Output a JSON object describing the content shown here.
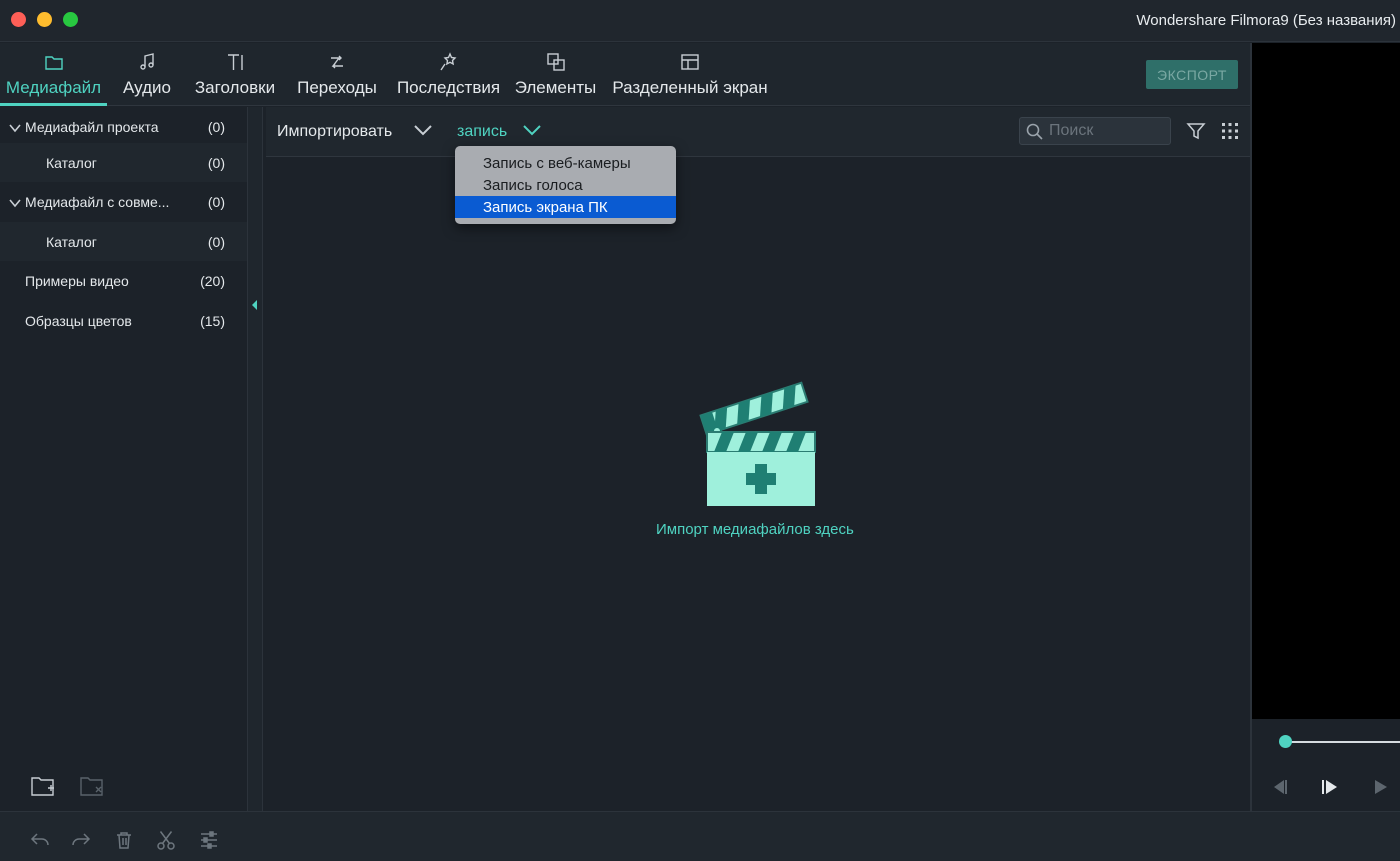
{
  "window": {
    "title": "Wondershare Filmora9 (Без названия)"
  },
  "tabs": [
    {
      "label": "Медиафайл",
      "icon": "folder-icon",
      "active": true
    },
    {
      "label": "Аудио",
      "icon": "music-note-icon",
      "active": false
    },
    {
      "label": "Заголовки",
      "icon": "text-icon",
      "active": false
    },
    {
      "label": "Переходы",
      "icon": "transition-icon",
      "active": false
    },
    {
      "label": "Последствия",
      "icon": "effects-icon",
      "active": false
    },
    {
      "label": "Элементы",
      "icon": "elements-icon",
      "active": false
    },
    {
      "label": "Разделенный экран",
      "icon": "split-screen-icon",
      "active": false
    }
  ],
  "export_label": "ЭКСПОРТ",
  "sidebar": {
    "items": [
      {
        "label": "Медиафайл проекта",
        "count": "(0)",
        "expanded": true
      },
      {
        "label": "Каталог",
        "count": "(0)"
      },
      {
        "label": "Медиафайл с совме...",
        "count": "(0)",
        "expanded": true
      },
      {
        "label": "Каталог",
        "count": "(0)"
      },
      {
        "label": "Примеры видео",
        "count": "(20)"
      },
      {
        "label": "Образцы цветов",
        "count": "(15)"
      }
    ]
  },
  "media_toolbar": {
    "import_label": "Импортировать",
    "record_label": "запись",
    "search_placeholder": "Поиск"
  },
  "record_menu": {
    "items": [
      {
        "label": "Запись с веб-камеры",
        "selected": false
      },
      {
        "label": "Запись голоса",
        "selected": false
      },
      {
        "label": "Запись экрана ПК",
        "selected": true
      }
    ]
  },
  "drop_area": {
    "text": "Импорт медиафайлов здесь"
  },
  "colors": {
    "accent": "#4fd3c1",
    "background": "#1c2229",
    "menu_selected": "#0a5bd2"
  }
}
